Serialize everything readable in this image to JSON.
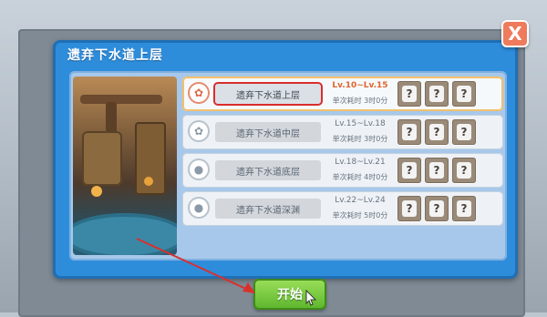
{
  "dialog": {
    "title": "遗弃下水道上层",
    "close_label": "X",
    "start_label": "开始"
  },
  "stages": [
    {
      "name": "遗弃下水道上层",
      "level": "Lv.10~Lv.15",
      "time": "单次耗时 3时0分",
      "icon": "cat-paw-icon",
      "selected": true,
      "rewards": [
        "?",
        "?",
        "?"
      ]
    },
    {
      "name": "遗弃下水道中层",
      "level": "Lv.15~Lv.18",
      "time": "单次耗时 3时0分",
      "icon": "cat-paw-icon",
      "selected": false,
      "rewards": [
        "?",
        "?",
        "?"
      ]
    },
    {
      "name": "遗弃下水道底层",
      "level": "Lv.18~Lv.21",
      "time": "单次耗时 4时0分",
      "icon": "bomb-icon",
      "selected": false,
      "rewards": [
        "?",
        "?",
        "?"
      ]
    },
    {
      "name": "遗弃下水道深渊",
      "level": "Lv.22~Lv.24",
      "time": "单次耗时 5时0分",
      "icon": "bomb-icon",
      "selected": false,
      "rewards": [
        "?",
        "?",
        "?"
      ]
    }
  ],
  "colors": {
    "dialog_blue": "#2e8ddb",
    "highlight_red": "#d92d2d",
    "start_green": "#5cb52c",
    "close_orange": "#ee7b5c",
    "level_active_orange": "#e0642c"
  }
}
